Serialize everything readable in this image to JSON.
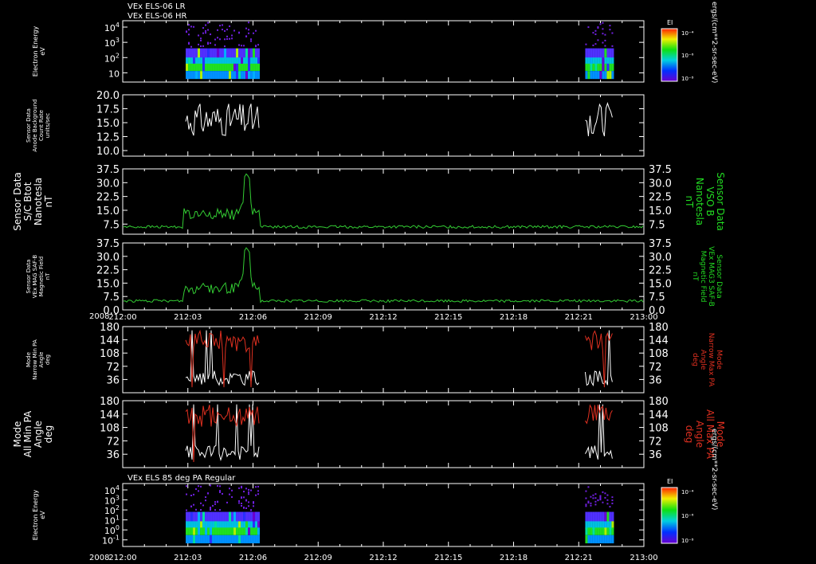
{
  "titles": {
    "top1": "VEx ELS-06 LR",
    "top2": "VEx ELS-06 HR",
    "bottom": "VEx ELS 85 deg PA Regular"
  },
  "year_label": "2008",
  "time_ticks": [
    "212:00",
    "212:03",
    "212:06",
    "212:09",
    "212:12",
    "212:15",
    "212:18",
    "212:21",
    "213:00"
  ],
  "colorbar": {
    "title": "EI",
    "tick_labels": [
      "10⁻⁴",
      "10⁻⁶",
      "10⁻⁸"
    ],
    "units": "ergs/(cm**2-sr-sec-eV)"
  },
  "chart_data": [
    {
      "type": "heatmap",
      "name": "spectrogram-top",
      "ylabel_lines": [
        "Electron Energy",
        "eV"
      ],
      "y_ticks": [
        {
          "base": "10",
          "exp": "4"
        },
        {
          "base": "10",
          "exp": "3"
        },
        {
          "base": "10",
          "exp": "2"
        },
        {
          "base": "10",
          "exp": ""
        }
      ],
      "active_intervals": [
        [
          "212:02.9",
          "212:06.3"
        ],
        [
          "212:21.3",
          "212:22.6"
        ]
      ]
    },
    {
      "type": "line",
      "name": "background",
      "ylabel_lines": [
        "Sensor Data",
        "Anode Background",
        "Count Rate",
        "units/sec"
      ],
      "ylim": [
        9,
        20
      ],
      "y_ticks": [
        "20.0",
        "17.5",
        "15.0",
        "12.5",
        "10.0"
      ],
      "series": [
        {
          "color": "#ffffff",
          "segments": [
            [
              "212:02.9",
              "212:06.3"
            ],
            [
              "212:21.3",
              "212:22.6"
            ]
          ],
          "range": [
            10,
            18.5
          ]
        }
      ]
    },
    {
      "type": "line",
      "name": "bmag-sc",
      "ylabel_lines": [
        "Sensor Data",
        "S/C Btot",
        "Nanotesla",
        "nT"
      ],
      "rlabel_lines": [
        "Sensor Data",
        "VSO B",
        "Nanotesla",
        "nT"
      ],
      "ylim": [
        2,
        37.5
      ],
      "y_ticks": [
        "37.5",
        "30.0",
        "22.5",
        "15.0",
        "7.5"
      ],
      "series": [
        {
          "color": "#33cc33",
          "baseline": 6
        }
      ],
      "events": [
        {
          "t": "212:03.7",
          "v": 15
        },
        {
          "t": "212:05.7",
          "v": 35
        }
      ]
    },
    {
      "type": "line",
      "name": "bmag-saf",
      "ylabel_lines": [
        "Sensor Data",
        "VEx MAG SAF-B",
        "Magnetic Field",
        "nT"
      ],
      "rlabel_lines": [
        "Sensor Data",
        "VEx MAG3 SAF-B",
        "Magnetic Field",
        "nT"
      ],
      "ylim": [
        0,
        37.5
      ],
      "y_ticks": [
        "37.5",
        "30.0",
        "22.5",
        "15.0",
        "7.5",
        "0.0"
      ],
      "series": [
        {
          "color": "#33cc33",
          "baseline": 5
        }
      ],
      "events": [
        {
          "t": "212:03.7",
          "v": 15
        },
        {
          "t": "212:05.7",
          "v": 35
        }
      ]
    },
    {
      "type": "line",
      "name": "pa-narrow",
      "ylabel_lines": [
        "Mode",
        "Narrow Min PA",
        "Angle",
        "deg"
      ],
      "rlabel_lines": [
        "Mode",
        "Narrow Max PA",
        "Angle",
        "deg"
      ],
      "ylim": [
        0,
        180
      ],
      "y_ticks": [
        "180",
        "144",
        "108",
        "72",
        "36"
      ],
      "series": [
        {
          "name": "min",
          "color": "#ffffff"
        },
        {
          "name": "max",
          "color": "#e03020"
        }
      ]
    },
    {
      "type": "line",
      "name": "pa-all",
      "ylabel_lines": [
        "Mode",
        "All Min PA",
        "Angle",
        "deg"
      ],
      "rlabel_lines": [
        "Mode",
        "All Max PA",
        "Angle",
        "deg"
      ],
      "ylim": [
        0,
        180
      ],
      "y_ticks": [
        "180",
        "144",
        "108",
        "72",
        "36"
      ],
      "series": [
        {
          "name": "min",
          "color": "#ffffff"
        },
        {
          "name": "max",
          "color": "#e03020"
        }
      ]
    },
    {
      "type": "heatmap",
      "name": "spectrogram-bottom",
      "ylabel_lines": [
        "Electron Energy",
        "eV"
      ],
      "y_ticks": [
        {
          "base": "10",
          "exp": "4"
        },
        {
          "base": "10",
          "exp": "3"
        },
        {
          "base": "10",
          "exp": "2"
        },
        {
          "base": "10",
          "exp": "1"
        },
        {
          "base": "10",
          "exp": "0"
        },
        {
          "base": "10",
          "exp": "-1"
        }
      ],
      "active_intervals": [
        [
          "212:02.9",
          "212:06.3"
        ],
        [
          "212:21.3",
          "212:22.6"
        ]
      ]
    }
  ]
}
